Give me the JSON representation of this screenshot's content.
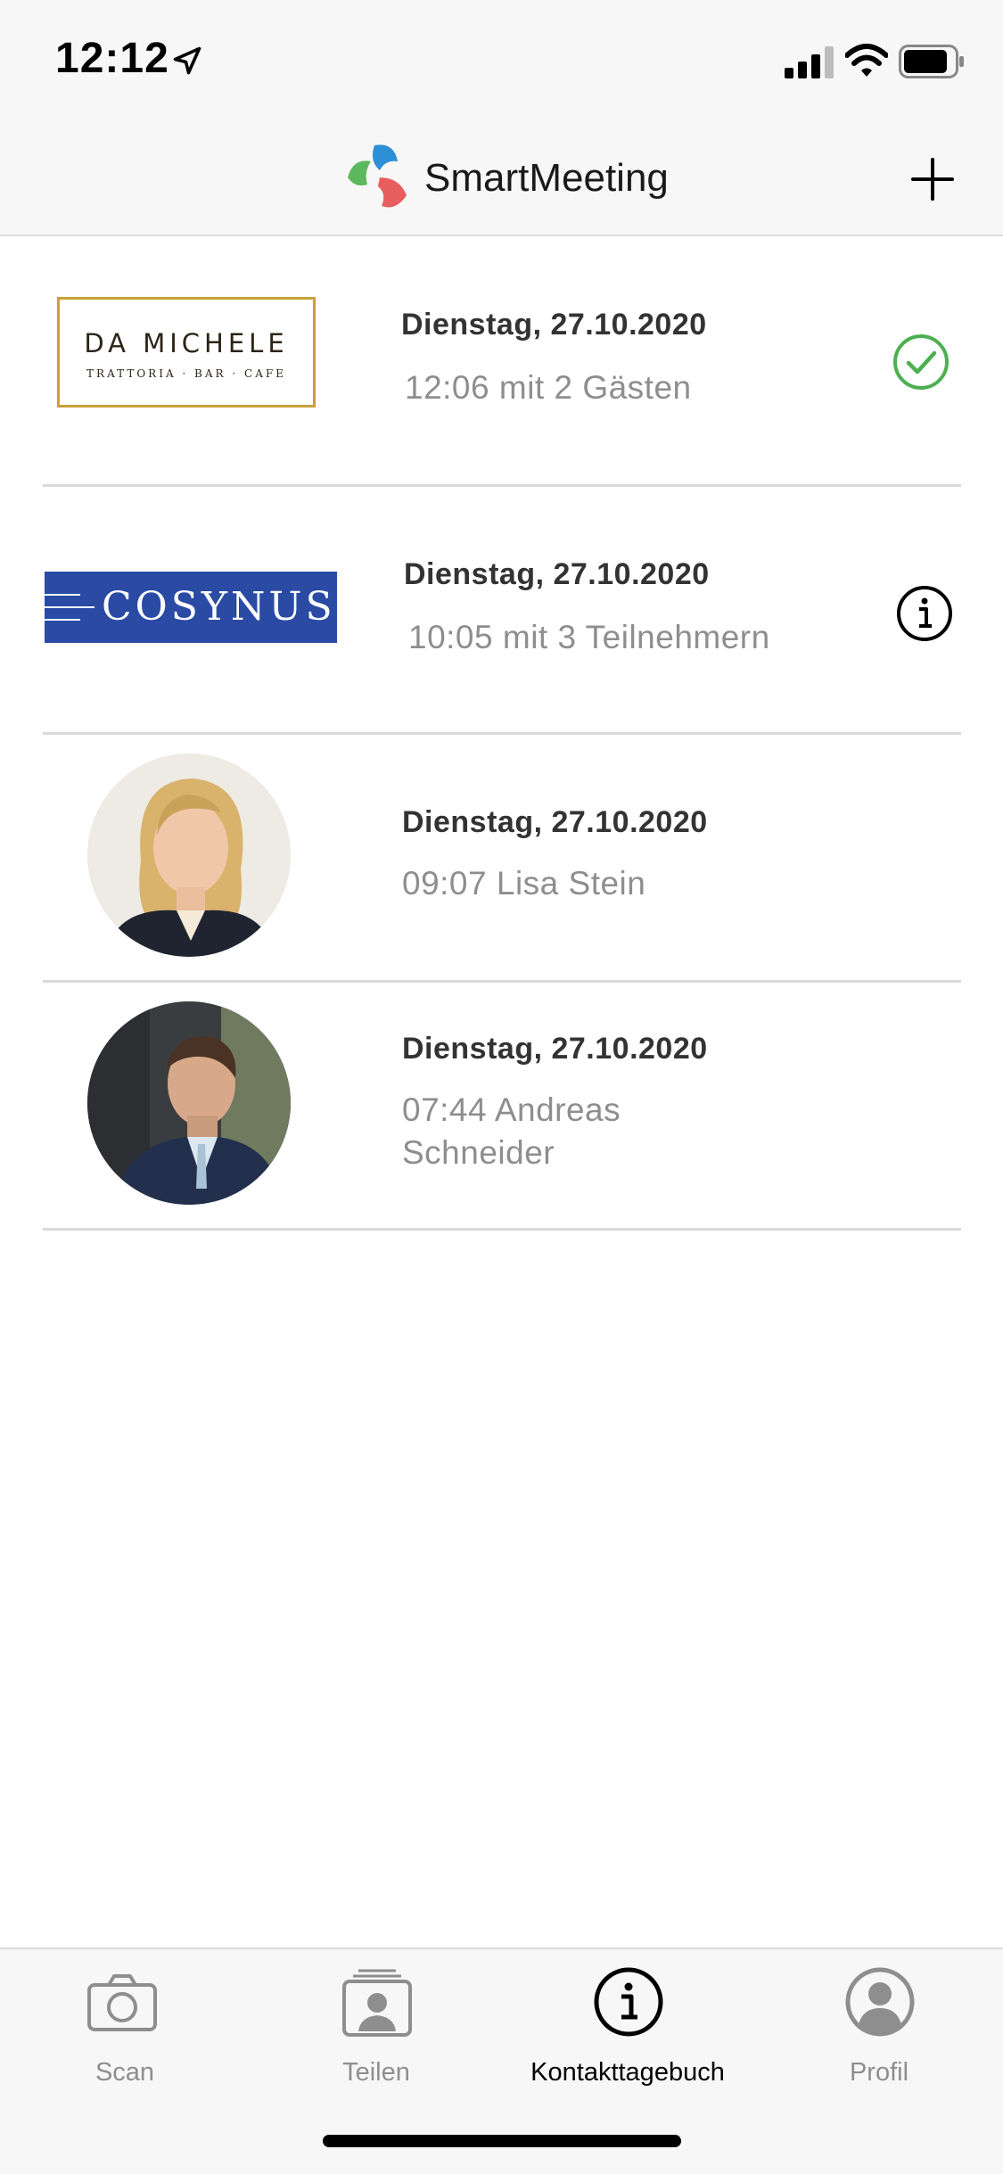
{
  "status_bar": {
    "time": "12:12"
  },
  "header": {
    "app_name": "SmartMeeting",
    "add_icon": "plus-icon"
  },
  "entries": [
    {
      "logo": "Da Michele logo",
      "logo_title": "DA MICHELE",
      "logo_subtitle": "TRATTORIA · BAR · CAFE",
      "date": "Dienstag, 27.10.2020",
      "detail": "12:06 mit 2 Gästen",
      "status_icon": "check-circle-icon",
      "status_color": "#4caf50"
    },
    {
      "logo": "Cosynus logo",
      "logo_title": "COSYNUS",
      "date": "Dienstag, 27.10.2020",
      "detail": "10:05 mit 3 Teilnehmern",
      "status_icon": "info-circle-icon"
    },
    {
      "avatar": "person-avatar",
      "date": "Dienstag, 27.10.2020",
      "detail": "09:07 Lisa Stein"
    },
    {
      "avatar": "person-avatar",
      "date": "Dienstag, 27.10.2020",
      "detail": "07:44 Andreas Schneider"
    }
  ],
  "tabs": [
    {
      "label": "Scan",
      "icon": "camera-icon"
    },
    {
      "label": "Teilen",
      "icon": "share-card-icon"
    },
    {
      "label": "Kontakttagebuch",
      "icon": "info-circle-icon",
      "active": true
    },
    {
      "label": "Profil",
      "icon": "user-circle-icon"
    }
  ],
  "colors": {
    "accent_green": "#4caf50",
    "cosynus_blue": "#2a4aa4",
    "gold_border": "#c9a13a"
  }
}
